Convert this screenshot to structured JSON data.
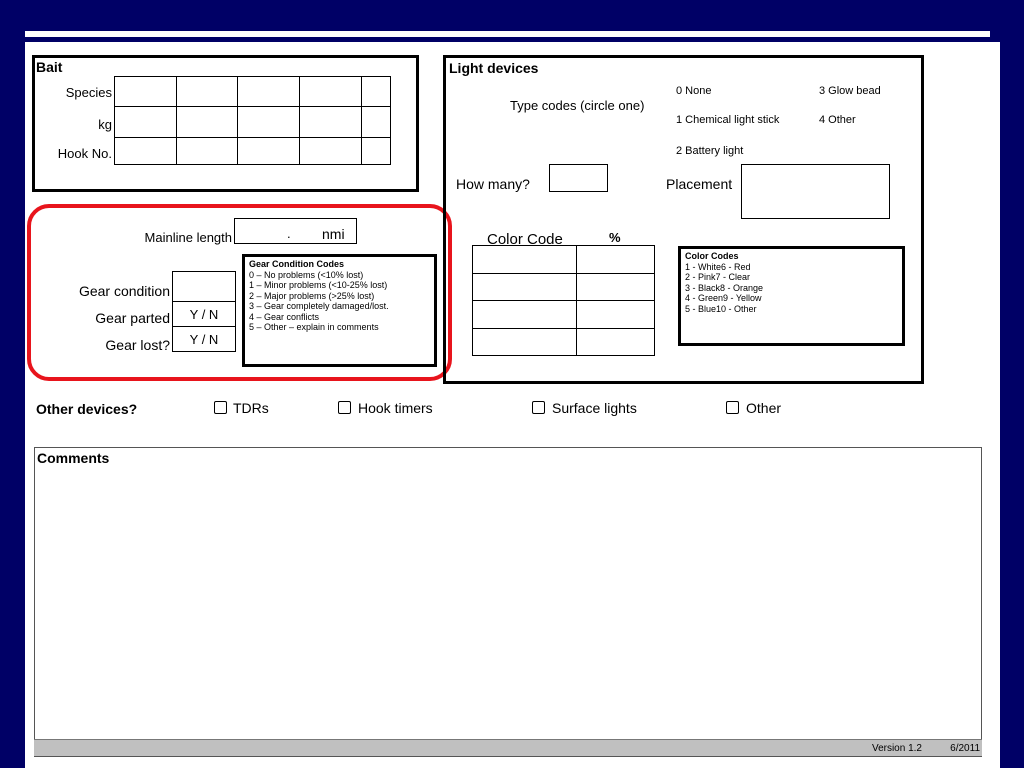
{
  "bait": {
    "title": "Bait",
    "rows": [
      "Species",
      "kg",
      "Hook No."
    ]
  },
  "mainline": {
    "label": "Mainline length",
    "dot": ".",
    "unit": "nmi"
  },
  "gear": {
    "condition_label": "Gear condition",
    "parted_label": "Gear parted",
    "parted_value": "Y / N",
    "lost_label": "Gear lost?",
    "lost_value": "Y / N",
    "codes_title": "Gear Condition Codes",
    "codes": [
      "0 – No problems  (<10% lost)",
      "1 – Minor problems  (<10-25% lost)",
      "2 – Major problems  (>25% lost)",
      "3 – Gear completely damaged/lost.",
      "4 – Gear conflicts",
      "5 – Other – explain in comments"
    ]
  },
  "light": {
    "title": "Light devices",
    "type_label": "Type codes (circle one)",
    "type_codes": [
      "0 None",
      "1 Chemical light stick",
      "2 Battery light",
      "3 Glow bead",
      "4 Other"
    ],
    "how_many_label": "How many?",
    "placement_label": "Placement",
    "color_code_header": "Color Code",
    "percent_header": "%",
    "color_codes_title": "Color Codes",
    "color_codes": [
      "1 - White6 - Red",
      "2 - Pink7 - Clear",
      "3 - Black8 - Orange",
      "4 - Green9 -   Yellow",
      "5 - Blue10 - Other"
    ]
  },
  "other_devices": {
    "label": "Other devices?",
    "options": [
      "TDRs",
      "Hook timers",
      "Surface lights",
      "Other"
    ]
  },
  "comments": {
    "label": "Comments"
  },
  "footer": {
    "version": "Version 1.2",
    "date": "6/2011"
  }
}
